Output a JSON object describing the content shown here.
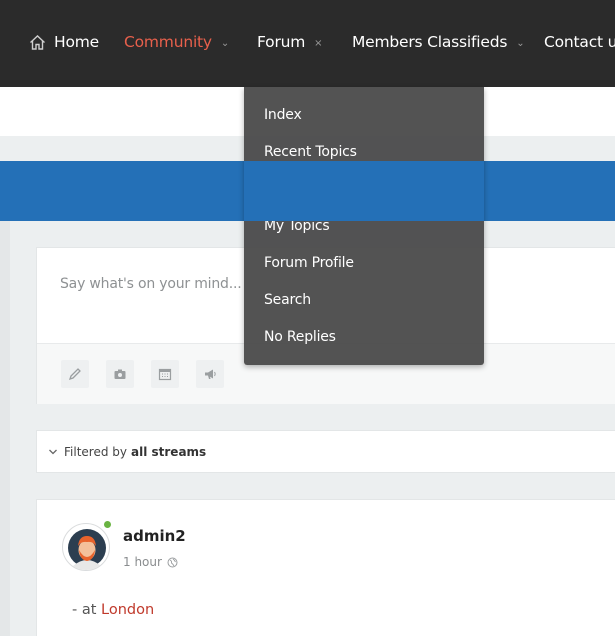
{
  "nav": {
    "items": [
      {
        "label": "Home",
        "icon": "home-icon"
      },
      {
        "label": "Community",
        "active": true
      },
      {
        "label": "Forum"
      },
      {
        "label": "Members Classifieds"
      },
      {
        "label": "Contact us"
      }
    ],
    "colors": {
      "background": "#2b2b2b",
      "active": "#e8604c"
    }
  },
  "forum_menu": {
    "items": [
      "Index",
      "Recent Topics",
      "",
      "My Topics",
      "Forum Profile",
      "Search",
      "No Replies"
    ]
  },
  "composer": {
    "placeholder": "Say what's on your mind...",
    "tools": [
      "pencil-icon",
      "camera-icon",
      "calendar-icon",
      "megaphone-icon"
    ]
  },
  "filter": {
    "prefix": "Filtered by",
    "value": "all streams"
  },
  "post": {
    "author": "admin2",
    "time": "1 hour",
    "location_prefix": "- at",
    "location": "London"
  },
  "colors": {
    "brand_blue": "#2470b7",
    "link_red": "#c0392b",
    "online_green": "#6ab442"
  }
}
